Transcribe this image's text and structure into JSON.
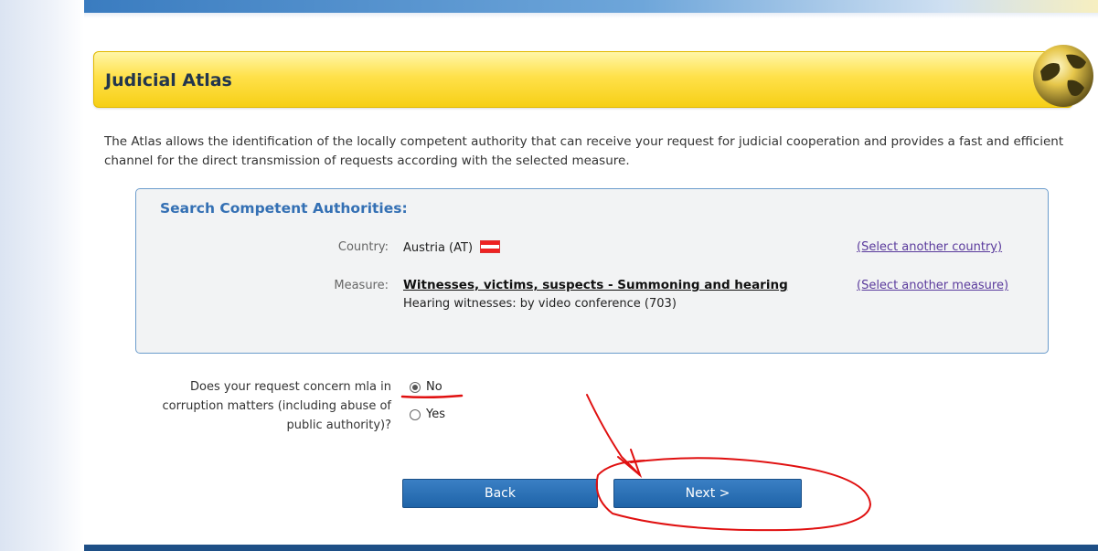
{
  "page": {
    "title": "Judicial Atlas",
    "intro": "The Atlas allows the identification of the locally competent authority that can receive your request for judicial cooperation and provides a fast and efficient channel for the direct transmission of requests according with the selected measure."
  },
  "search": {
    "heading": "Search Competent Authorities:",
    "country_label": "Country:",
    "country_value": "Austria (AT)",
    "country_link": "(Select another country)",
    "measure_label": "Measure:",
    "measure_value": "Witnesses, victims, suspects - Summoning and hearing",
    "measure_sub": "Hearing witnesses: by video conference (703)",
    "measure_link": "(Select another measure)"
  },
  "question": {
    "text": "Does your request concern mla in corruption matters (including abuse of public authority)?",
    "options": [
      {
        "label": "No",
        "checked": true
      },
      {
        "label": "Yes",
        "checked": false
      }
    ]
  },
  "buttons": {
    "back": "Back",
    "next": "Next >"
  },
  "colors": {
    "title_bar": "#ffe14a",
    "button": "#2a72b8",
    "annotation": "#e01010",
    "link": "#5a3a9c"
  },
  "icons": [
    "globe-icon",
    "austria-flag-icon"
  ]
}
